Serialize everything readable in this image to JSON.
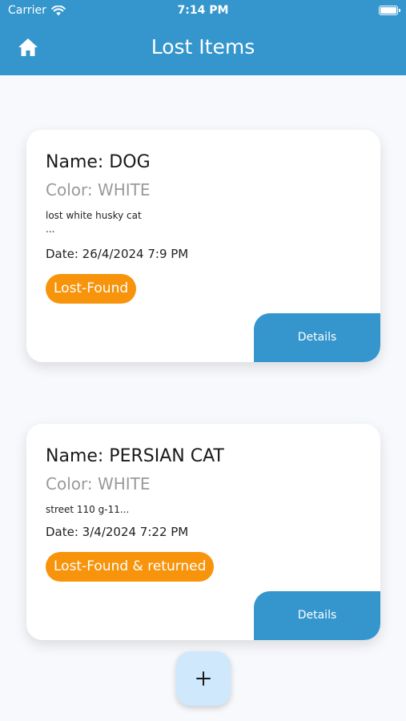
{
  "status_bar": {
    "carrier": "Carrier",
    "time": "7:14 PM"
  },
  "header": {
    "title": "Lost Items",
    "home_icon": "home-icon"
  },
  "items": [
    {
      "name": "Name: DOG",
      "color": "Color: WHITE",
      "description": "lost white husky cat\n...",
      "date": "Date:  26/4/2024 7:9 PM",
      "status": "Lost-Found",
      "details_label": "Details"
    },
    {
      "name": "Name: PERSIAN CAT",
      "color": "Color: WHITE",
      "description": "street 110 g-11...",
      "date": "Date:  3/4/2024 7:22 PM",
      "status": "Lost-Found & returned",
      "details_label": "Details"
    }
  ],
  "colors": {
    "primary": "#3496cc",
    "badge": "#f7940c",
    "fab": "#cfe8fb"
  },
  "fab_icon": "plus-icon"
}
